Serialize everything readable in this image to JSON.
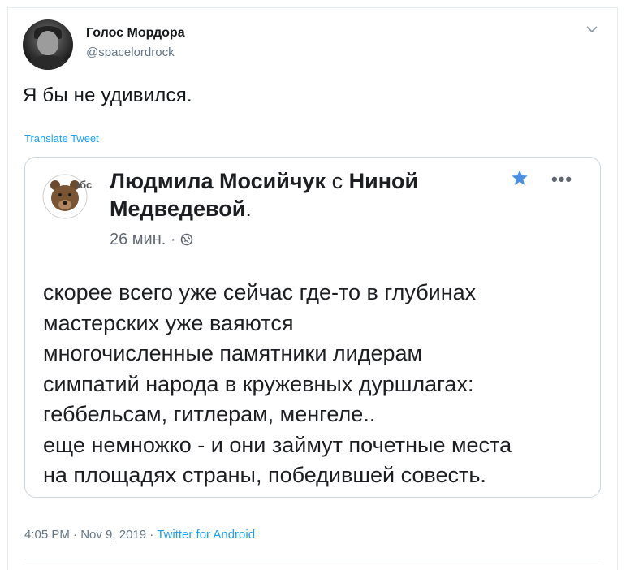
{
  "tweet": {
    "author_name": "Голос Мордора",
    "author_handle": "@spacelordrock",
    "text": "Я бы не удивился.",
    "translate_label": "Translate Tweet",
    "time": "4:05 PM",
    "date": "Nov 9, 2019",
    "separator": "·",
    "source": "Twitter for Android"
  },
  "embedded_post": {
    "avatar_label": "збс",
    "author": "Людмила Мосийчук",
    "with_word": "с",
    "tagged_line1": "Ниной",
    "tagged_line2": "Медведевой",
    "period": ".",
    "time_ago": "26 мин.",
    "dot": "·",
    "body_lines": [
      "скорее всего уже сейчас где-то в глубинах",
      "мастерских уже ваяются",
      "многочисленные памятники лидерам",
      "симпатий народа в кружевных дуршлагах:",
      "геббельсам, гитлерам, менгеле..",
      "еще немножко - и они займут почетные места",
      "на площадях страны, победившей совесть."
    ],
    "more_glyph": "•••",
    "star_color": "#4a90e2"
  },
  "colors": {
    "link": "#1da1f2",
    "secondary": "#657786",
    "primary": "#14171a"
  }
}
